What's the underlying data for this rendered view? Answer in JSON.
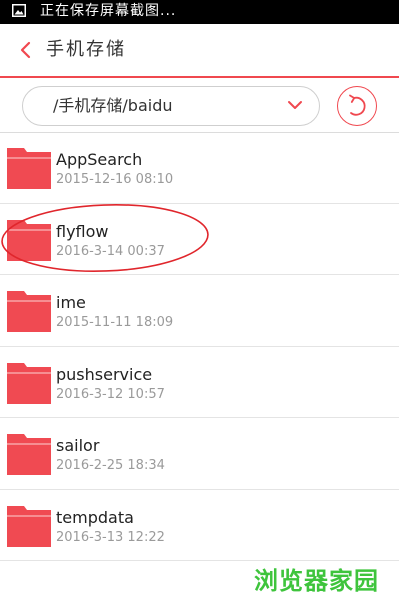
{
  "status_bar": {
    "text": "正在保存屏幕截图..."
  },
  "header": {
    "title": "手机存储"
  },
  "path_bar": {
    "path": "/手机存储/baidu"
  },
  "files": [
    {
      "name": "AppSearch",
      "date": "2015-12-16 08:10"
    },
    {
      "name": "flyflow",
      "date": "2016-3-14 00:37"
    },
    {
      "name": "ime",
      "date": "2015-11-11 18:09"
    },
    {
      "name": "pushservice",
      "date": "2016-3-12 10:57"
    },
    {
      "name": "sailor",
      "date": "2016-2-25 18:34"
    },
    {
      "name": "tempdata",
      "date": "2016-3-13 12:22"
    }
  ],
  "watermark": "浏览器家园",
  "colors": {
    "accent": "#f0484f",
    "folder": "#f04a52",
    "watermark": "#3ec43c"
  },
  "icons": {
    "status": "screenshot-icon",
    "back": "back-chevron-icon",
    "dropdown": "chevron-down-icon",
    "refresh": "refresh-icon",
    "folder": "folder-icon"
  }
}
